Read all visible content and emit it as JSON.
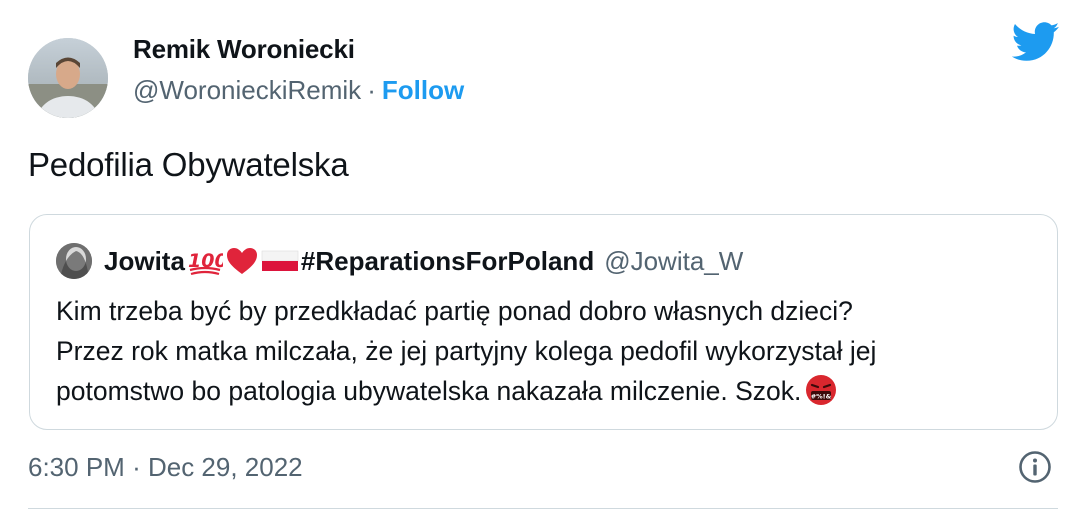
{
  "author": {
    "name": "Remik Woroniecki",
    "handle": "@WoronieckiRemik",
    "separator": "·",
    "follow_label": "Follow",
    "avatar_icon": "profile-photo"
  },
  "brand_icon": "twitter-bird-icon",
  "tweet": {
    "text": "Pedofilia Obywatelska"
  },
  "quoted_tweet": {
    "author_name": "Jowita",
    "author_hashtag": "#ReparationsForPoland",
    "author_handle": "@Jowita_W",
    "name_emojis": [
      "hundred-points-icon",
      "red-heart-icon",
      "poland-flag-icon"
    ],
    "body_lines": [
      "Kim trzeba być by przedkładać partię ponad dobro własnych dzieci?",
      "Przez rok matka milczała, że jej partyjny kolega pedofil wykorzystał jej",
      "potomstwo bo patologia ubywatelska nakazała milczenie. Szok."
    ],
    "body_emoji": "face-with-symbols-icon"
  },
  "meta": {
    "time": "6:30 PM",
    "separator": "·",
    "date": "Dec 29, 2022",
    "info_icon": "info-icon"
  },
  "colors": {
    "accent": "#1d9bf0",
    "text": "#0f1419",
    "secondary": "#536471",
    "border": "#cfd9de"
  }
}
